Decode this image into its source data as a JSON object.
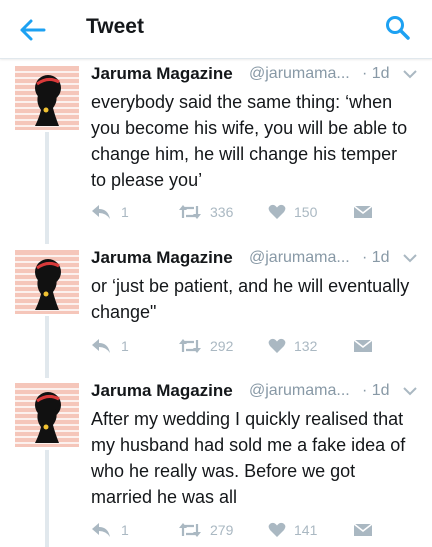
{
  "header": {
    "title": "Tweet",
    "accent_color": "#1da1f2",
    "back_icon": "arrow-left-icon",
    "search_icon": "search-icon"
  },
  "tweets": [
    {
      "name": "Jaruma Magazine",
      "handle": "@jarumama...",
      "time": "· 1d",
      "text": "everybody said the same thing: ‘when you become his wife, you will be able to change him, he will change his temper to please you’",
      "replies": "1",
      "retweets": "336",
      "likes": "150"
    },
    {
      "name": "Jaruma Magazine",
      "handle": "@jarumama...",
      "time": "· 1d",
      "text": "or ‘just be patient, and he will eventually change\"",
      "replies": "1",
      "retweets": "292",
      "likes": "132"
    },
    {
      "name": "Jaruma Magazine",
      "handle": "@jarumama...",
      "time": "· 1d",
      "text": "After my wedding I quickly realised that my husband had sold me a fake idea of who he really was. Before we got married he was all",
      "replies": "1",
      "retweets": "279",
      "likes": "141"
    }
  ],
  "colors": {
    "avatar_bg": "#f5c6ba",
    "avatar_stripe": "#ffffff",
    "icon_gray": "#aab8c2",
    "text_secondary": "#8899a6"
  }
}
